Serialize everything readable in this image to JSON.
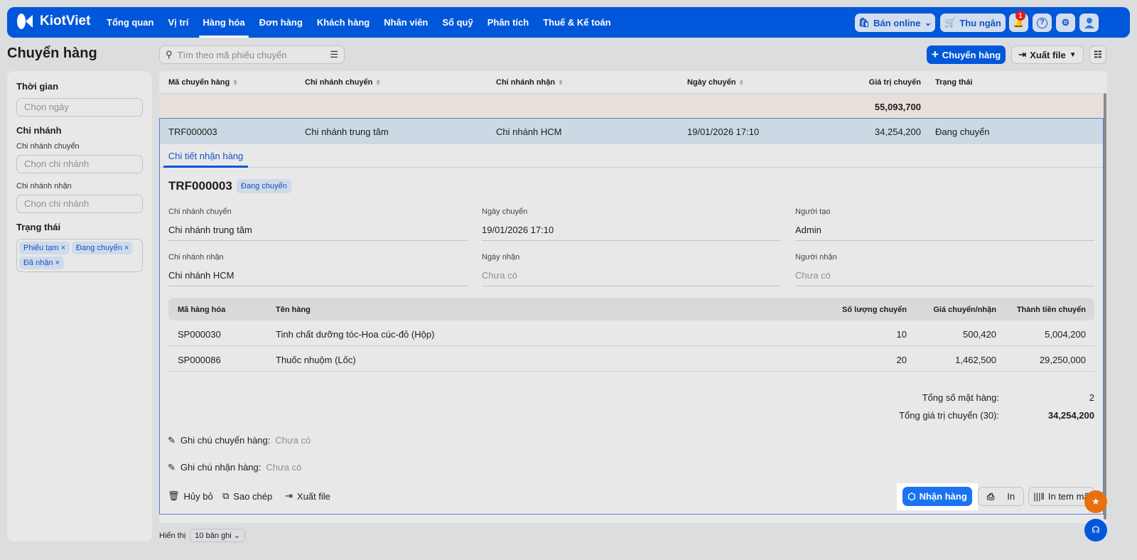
{
  "nav": {
    "brand": "KiotViet",
    "items": [
      "Tổng quan",
      "Vị trí",
      "Hàng hóa",
      "Đơn hàng",
      "Khách hàng",
      "Nhân viên",
      "Sổ quỹ",
      "Phân tích",
      "Thuế & Kế toán"
    ],
    "active": "Hàng hóa",
    "online": "Bán online",
    "cashier": "Thu ngân",
    "notif_count": "1"
  },
  "page": {
    "title": "Chuyển hàng",
    "search_placeholder": "Tìm theo mã phiếu chuyển",
    "add": "Chuyển hàng",
    "export": "Xuất file"
  },
  "sidebar": {
    "time": "Thời gian",
    "time_ph": "Chọn ngày",
    "branch": "Chi nhánh",
    "from": "Chi nhánh chuyển",
    "from_ph": "Chọn chi nhánh",
    "to": "Chi nhánh nhận",
    "to_ph": "Chọn chi nhánh",
    "status": "Trạng thái",
    "tags": [
      "Phiếu tạm",
      "Đang chuyển",
      "Đã nhận"
    ]
  },
  "table": {
    "headers": [
      "Mã chuyển hàng",
      "Chi nhánh chuyển",
      "Chi nhánh nhận",
      "Ngày chuyển",
      "Giá trị chuyển",
      "Trạng thái"
    ],
    "total": "55,093,700",
    "row": {
      "code": "TRF000003",
      "from": "Chi nhánh trung tâm",
      "to": "Chi nhánh HCM",
      "date": "19/01/2026 17:10",
      "value": "34,254,200",
      "status": "Đang chuyển"
    }
  },
  "detail": {
    "tab": "Chi tiết nhận hàng",
    "code": "TRF000003",
    "status": "Đang chuyển",
    "fields": [
      {
        "label": "Chi nhánh chuyển",
        "value": "Chi nhánh trung tâm"
      },
      {
        "label": "Ngày chuyển",
        "value": "19/01/2026 17:10"
      },
      {
        "label": "Người tạo",
        "value": "Admin"
      },
      {
        "label": "Chi nhánh nhận",
        "value": "Chi nhánh HCM"
      },
      {
        "label": "Ngày nhận",
        "value": "Chưa có"
      },
      {
        "label": "Người nhận",
        "value": "Chưa có"
      }
    ],
    "item_headers": [
      "Mã hàng hóa",
      "Tên hàng",
      "Số lượng chuyển",
      "Giá chuyển/nhận",
      "Thành tiền chuyển"
    ],
    "items": [
      [
        "SP000030",
        "Tinh chất dưỡng tóc-Hoa cúc-đỏ (Hộp)",
        "10",
        "500,420",
        "5,004,200"
      ],
      [
        "SP000086",
        "Thuốc nhuộm (Lốc)",
        "20",
        "1,462,500",
        "29,250,000"
      ]
    ],
    "count_label": "Tổng số mặt hàng:",
    "count": "2",
    "total_label": "Tổng giá trị chuyển (30):",
    "total": "34,254,200",
    "note_send_label": "Ghi chú chuyển hàng:",
    "note_send": "Chưa có",
    "note_recv_label": "Ghi chú nhận hàng:",
    "note_recv": "Chưa có",
    "actions": {
      "cancel": "Hủy bỏ",
      "copy": "Sao chép",
      "export": "Xuất file",
      "receive": "Nhận hàng",
      "print": "In",
      "label": "In tem mã"
    }
  },
  "footer": {
    "show": "Hiển thị",
    "per_page": "10 bản ghi"
  }
}
